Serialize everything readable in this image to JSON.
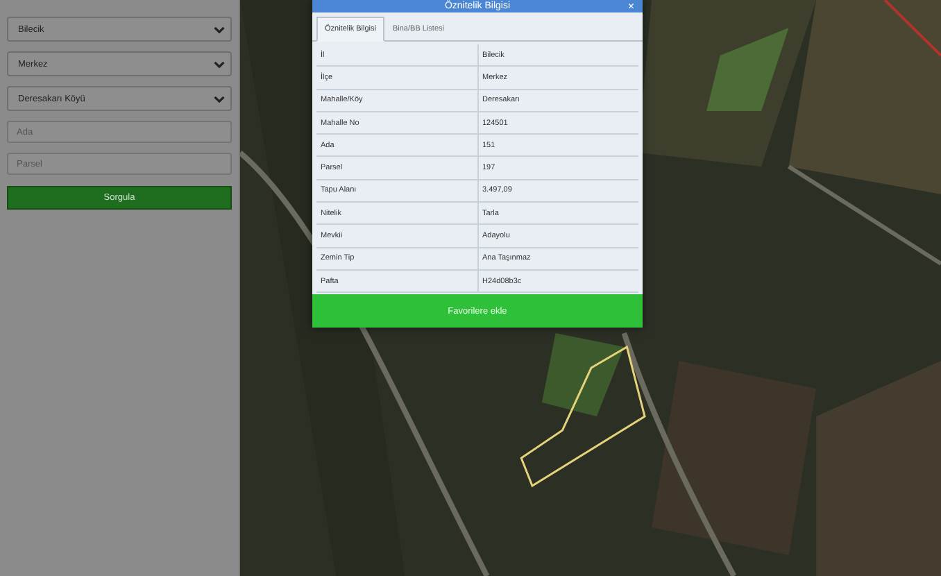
{
  "sidebar": {
    "selects": [
      {
        "value": "Bilecik"
      },
      {
        "value": "Merkez"
      },
      {
        "value": "Deresakarı Köyü"
      }
    ],
    "inputs": [
      {
        "placeholder": "Ada"
      },
      {
        "placeholder": "Parsel"
      }
    ],
    "button": "Sorgula"
  },
  "dialog": {
    "title": "Öznitelik Bilgisi",
    "close": "×",
    "tabs": [
      {
        "label": "Öznitelik Bilgisi",
        "selected": true
      },
      {
        "label": "Bina/BB Listesi",
        "selected": false
      }
    ],
    "rows": [
      {
        "key": "İl",
        "value": "Bilecik"
      },
      {
        "key": "İlçe",
        "value": "Merkez"
      },
      {
        "key": "Mahalle/Köy",
        "value": "Deresakarı"
      },
      {
        "key": "Mahalle No",
        "value": "124501"
      },
      {
        "key": "Ada",
        "value": "151"
      },
      {
        "key": "Parsel",
        "value": "197"
      },
      {
        "key": "Tapu Alanı",
        "value": "3.497,09"
      },
      {
        "key": "Nitelik",
        "value": "Tarla"
      },
      {
        "key": "Mevkii",
        "value": "Adayolu"
      },
      {
        "key": "Zemin Tip",
        "value": "Ana Taşınmaz"
      },
      {
        "key": "Pafta",
        "value": "H24d08b3c"
      }
    ],
    "button": "Favorilere ekle"
  }
}
